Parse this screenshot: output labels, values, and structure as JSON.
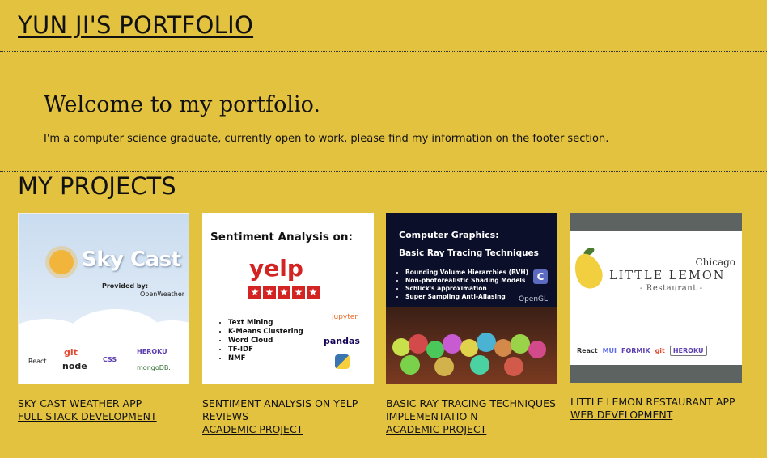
{
  "header": {
    "title": "YUN JI'S PORTFOLIO"
  },
  "hero": {
    "heading": "Welcome to my portfolio.",
    "text": "I'm a computer science graduate, currently open to work, please find my information on the footer section."
  },
  "projects": {
    "title": "MY PROJECTS",
    "items": [
      {
        "name": "SKY CAST WEATHER APP",
        "category": "FULL STACK DEVELOPMENT",
        "thumb": {
          "title": "Sky Cast",
          "provided": "Provided by:",
          "provider": "OpenWeather",
          "tech": [
            "React",
            "git",
            "node",
            "CSS",
            "HEROKU",
            "mongoDB."
          ]
        }
      },
      {
        "name": "SENTIMENT ANALYSIS ON YELP REVIEWS",
        "category": "ACADEMIC PROJECT",
        "thumb": {
          "title": "Sentiment Analysis on:",
          "logo": "yelp",
          "list": [
            "Text Mining",
            "K-Means Clustering",
            "Word Cloud",
            "TF-IDF",
            "NMF"
          ],
          "tech": [
            "jupyter",
            "pandas"
          ]
        }
      },
      {
        "name": "BASIC RAY TRACING TECHNIQUES IMPLEMENTATIO N",
        "category": "ACADEMIC PROJECT",
        "thumb": {
          "title": "Computer Graphics:",
          "subtitle": "Basic Ray Tracing Techniques",
          "list": [
            "Bounding Volume Hierarchies (BVH)",
            "Non-photorealistic Shading Models",
            "Schlick's approximation",
            "Super Sampling Anti-Aliasing"
          ],
          "tech": [
            "C",
            "OpenGL"
          ]
        }
      },
      {
        "name": "LITTLE LEMON RESTAURANT APP",
        "category": "WEB DEVELOPMENT",
        "thumb": {
          "city": "Chicago",
          "title": "LITTLE LEMON",
          "sub": "- Restaurant -",
          "tech": [
            "React",
            "MUI",
            "FORMIK",
            "git",
            "HEROKU"
          ]
        }
      }
    ]
  }
}
